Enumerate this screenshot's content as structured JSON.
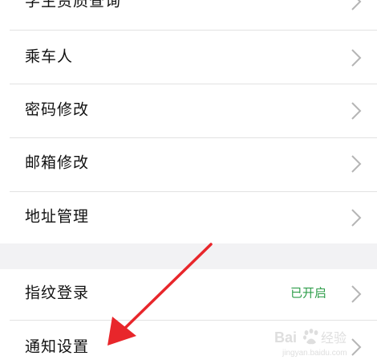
{
  "settings": {
    "rows": [
      {
        "label": "学生资质查询"
      },
      {
        "label": "乘车人"
      },
      {
        "label": "密码修改"
      },
      {
        "label": "邮箱修改"
      },
      {
        "label": "地址管理"
      }
    ],
    "rows2": [
      {
        "label": "指纹登录",
        "value": "已开启"
      },
      {
        "label": "通知设置"
      }
    ]
  },
  "colors": {
    "status_on": "#2e9d4a",
    "annotation_arrow": "#e8262b",
    "section_background": "#f2f2f4"
  },
  "watermark": {
    "brand": "Baidu经验",
    "url": "jingyan.baidu.com"
  }
}
